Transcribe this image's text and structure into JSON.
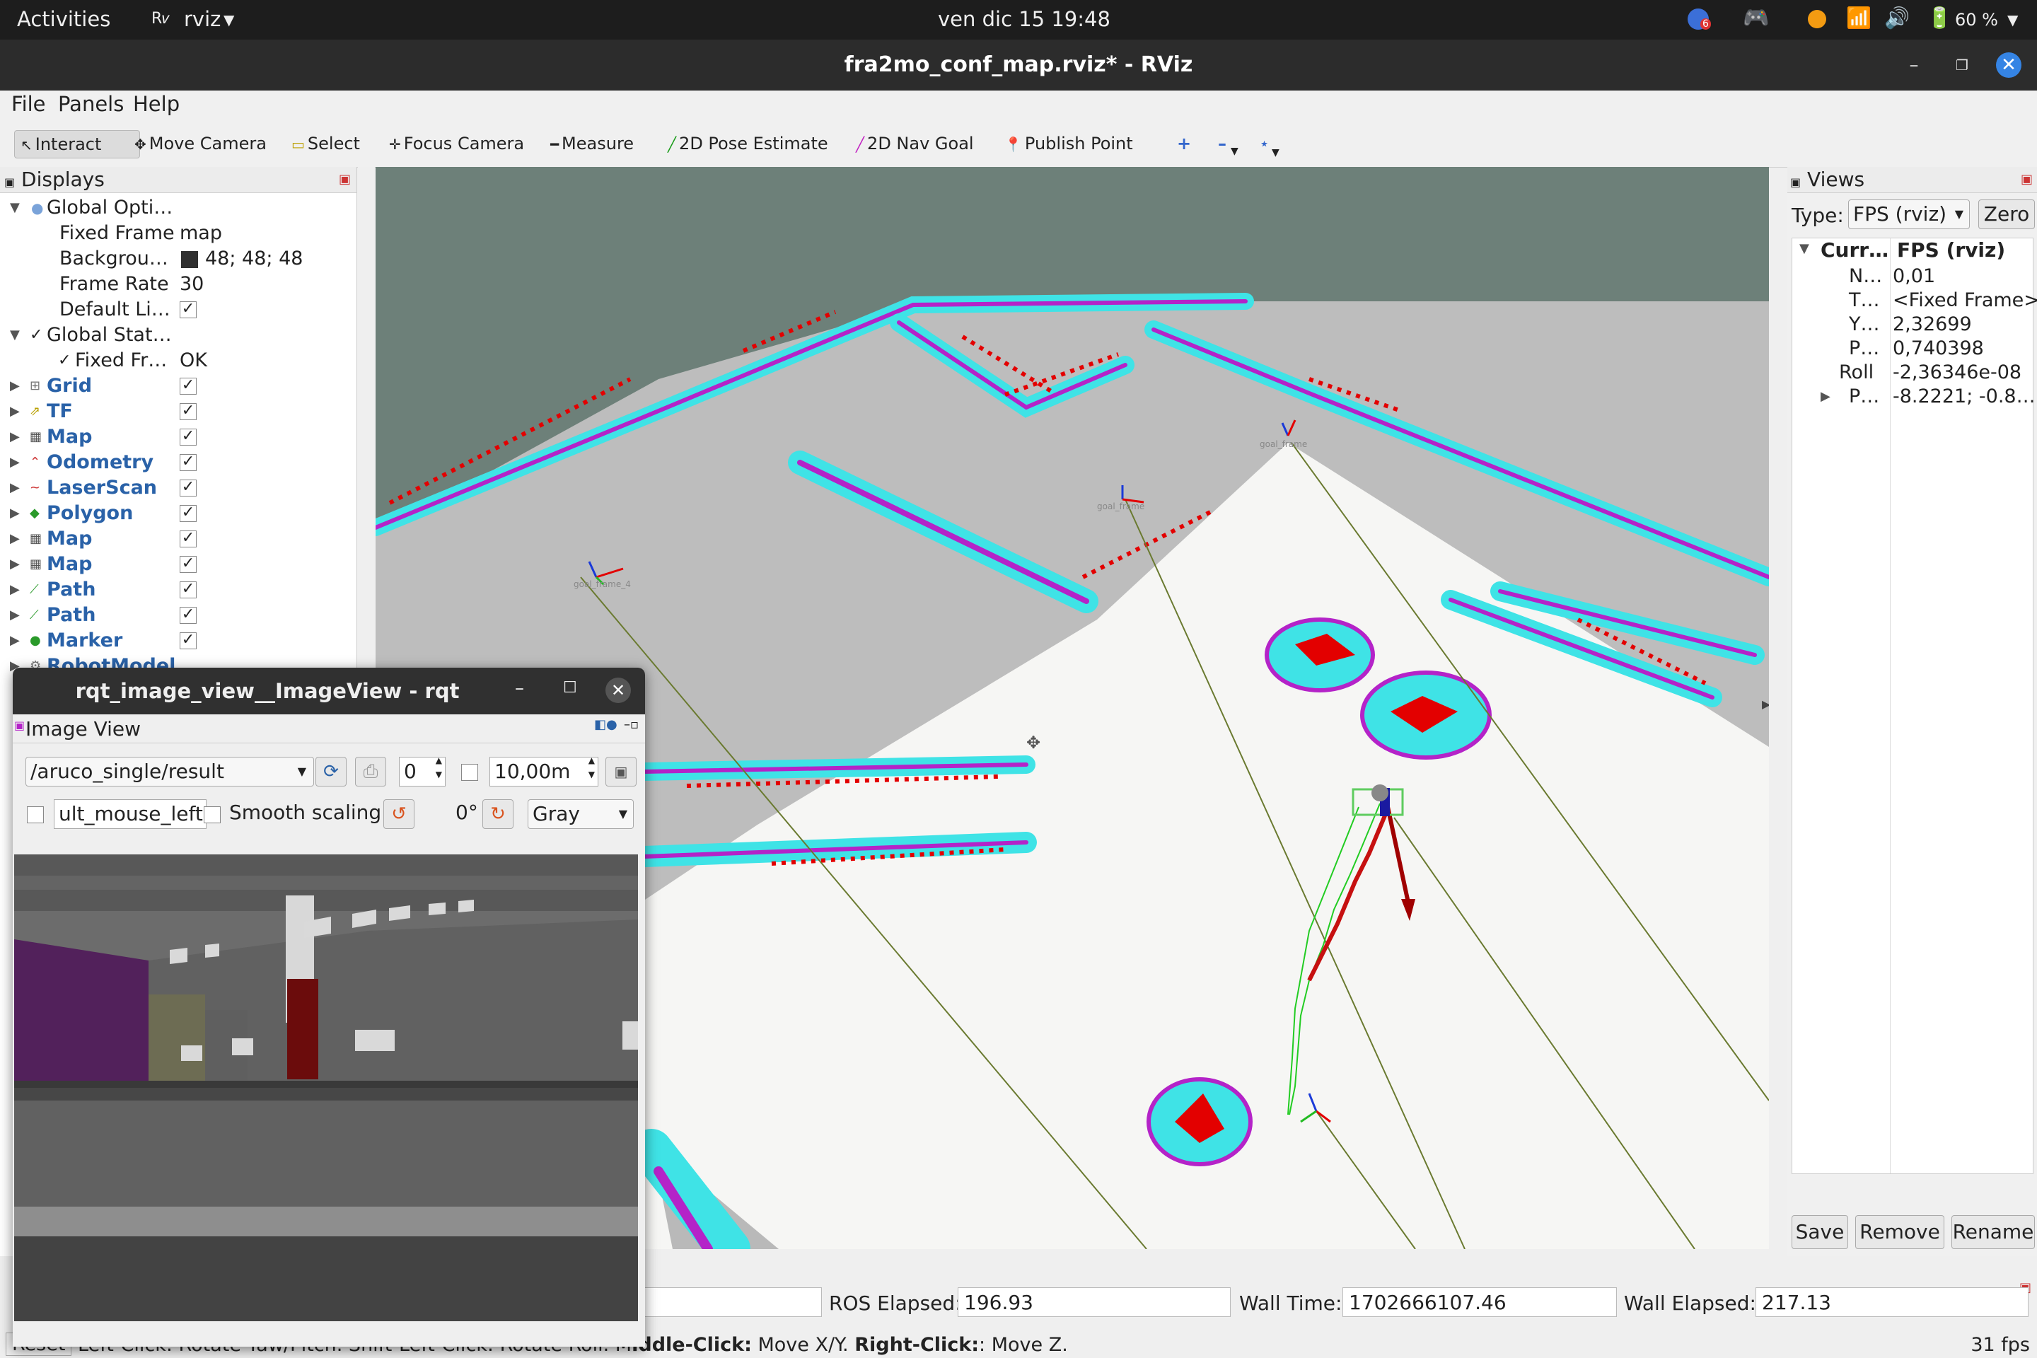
{
  "topbar": {
    "activities": "Activities",
    "app_name": "rviz",
    "clock": "ven dic 15  19:48",
    "battery": "60 %",
    "notif_count": "6"
  },
  "window": {
    "title": "fra2mo_conf_map.rviz* - RViz"
  },
  "menu": [
    "File",
    "Panels",
    "Help"
  ],
  "toolbar": {
    "interact": "Interact",
    "move_camera": "Move Camera",
    "select": "Select",
    "focus_camera": "Focus Camera",
    "measure": "Measure",
    "pose_estimate": "2D Pose Estimate",
    "nav_goal": "2D Nav Goal",
    "publish_point": "Publish Point"
  },
  "displays": {
    "title": "Displays",
    "global_options": "Global Opti…",
    "fixed_frame_label": "Fixed Frame",
    "fixed_frame_value": "map",
    "background_label": "Backgrou…",
    "background_value": "48; 48; 48",
    "frame_rate_label": "Frame Rate",
    "frame_rate_value": "30",
    "default_light_label": "Default Li…",
    "global_status": "Global Stat…",
    "fixed_fr_status_label": "Fixed Fr…",
    "fixed_fr_status_value": "OK",
    "items": [
      {
        "name": "Grid",
        "icon": "grid-icon"
      },
      {
        "name": "TF",
        "icon": "tf-icon"
      },
      {
        "name": "Map",
        "icon": "map-icon"
      },
      {
        "name": "Odometry",
        "icon": "odometry-icon"
      },
      {
        "name": "LaserScan",
        "icon": "laserscan-icon"
      },
      {
        "name": "Polygon",
        "icon": "polygon-icon"
      },
      {
        "name": "Map",
        "icon": "map-icon"
      },
      {
        "name": "Map",
        "icon": "map-icon"
      },
      {
        "name": "Path",
        "icon": "path-icon"
      },
      {
        "name": "Path",
        "icon": "path-icon"
      },
      {
        "name": "Marker",
        "icon": "marker-icon"
      },
      {
        "name": "RobotModel",
        "icon": "robot-icon"
      }
    ]
  },
  "view3d": {
    "goal_labels": [
      "goal_frame_4",
      "goal_frame",
      "goal_frame"
    ]
  },
  "views": {
    "title": "Views",
    "type_label": "Type:",
    "type_value": "FPS (rviz)",
    "zero": "Zero",
    "current_label": "Curr…",
    "current_value": "FPS (rviz)",
    "props": [
      {
        "k": "N…",
        "v": "0,01"
      },
      {
        "k": "T…",
        "v": "<Fixed Frame>"
      },
      {
        "k": "Y…",
        "v": "2,32699"
      },
      {
        "k": "P…",
        "v": "0,740398"
      },
      {
        "k": "Roll",
        "v": "-2,36346e-08"
      },
      {
        "k": "P…",
        "v": "-8.2221; -0.8…"
      }
    ],
    "save": "Save",
    "remove": "Remove",
    "rename": "Rename"
  },
  "time": {
    "ros_elapsed_label": "ROS Elapsed:",
    "ros_elapsed": "196.93",
    "wall_time_label": "Wall Time:",
    "wall_time": "1702666107.46",
    "wall_elapsed_label": "Wall Elapsed:",
    "wall_elapsed": "217.13"
  },
  "status": {
    "reset": "Reset",
    "hint_left": "Left-Click: Rotate Yaw/Pitch. Shift-Left-Click: Rotate Roll. M",
    "hint_middle_key": "iddle-Click:",
    "hint_middle": " Move X/Y. ",
    "hint_right_key": "Right-Click:",
    "hint_right": ": Move Z.",
    "fps": "31 fps"
  },
  "rqt": {
    "title": "rqt_image_view__ImageView - rqt",
    "panel": "Image View",
    "topic": "/aruco_single/result",
    "spin1": "0",
    "spin2": "10,00m",
    "mouse_topic": "ult_mouse_left",
    "smooth_scaling": "Smooth scaling",
    "rotation": "0°",
    "color_mode": "Gray"
  },
  "colors": {
    "rviz_background": "#6d8079",
    "floor": "#bdbdbd",
    "free_space": "#f6f6f4",
    "costmap_cyan": "#3fe3e6",
    "costmap_magenta": "#b423c8",
    "obstacle_red": "#e30000"
  }
}
